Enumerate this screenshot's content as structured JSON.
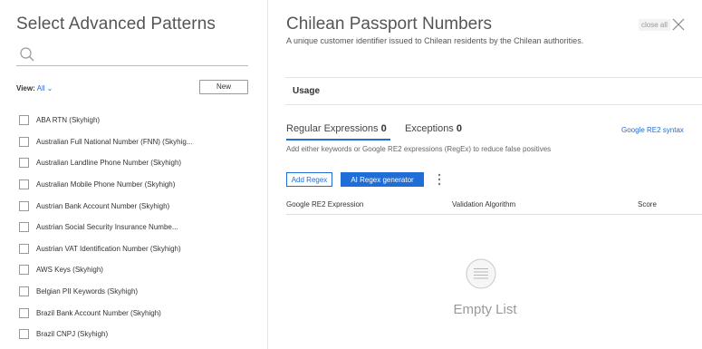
{
  "left_panel": {
    "title": "Select Advanced Patterns",
    "search": {
      "value": "",
      "placeholder": "",
      "icon": "search-icon"
    },
    "view": {
      "label": "View:",
      "value": "All"
    },
    "new_button_label": "New",
    "patterns": [
      {
        "label": "ABA RTN (Skyhigh)",
        "checked": false
      },
      {
        "label": "Australian Full National Number (FNN) (Skyhig...",
        "checked": false
      },
      {
        "label": "Australian Landline Phone Number (Skyhigh)",
        "checked": false
      },
      {
        "label": "Australian Mobile Phone Number (Skyhigh)",
        "checked": false
      },
      {
        "label": "Austrian Bank Account Number (Skyhigh)",
        "checked": false
      },
      {
        "label": "Austrian Social Security Insurance Numbe...",
        "checked": false
      },
      {
        "label": "Austrian VAT Identification Number (Skyhigh)",
        "checked": false
      },
      {
        "label": "AWS Keys (Skyhigh)",
        "checked": false
      },
      {
        "label": "Belgian PII Keywords (Skyhigh)",
        "checked": false
      },
      {
        "label": "Brazil Bank Account Number (Skyhigh)",
        "checked": false
      },
      {
        "label": "Brazil CNPJ (Skyhigh)",
        "checked": false
      }
    ]
  },
  "right_panel": {
    "title": "Chilean Passport Numbers",
    "subtitle": "A unique customer identifier issued to Chilean residents by the Chilean authorities.",
    "close_all_label": "close all",
    "usage_label": "Usage",
    "tabs": [
      {
        "label": "Regular Expressions",
        "count": "0",
        "active": true
      },
      {
        "label": "Exceptions",
        "count": "0",
        "active": false
      }
    ],
    "google_syntax_link": "Google RE2 syntax",
    "hint": "Add either keywords or Google RE2 expressions (RegEx) to reduce false positives",
    "add_regex_label": "Add Regex",
    "ai_regex_label": "AI Regex generator",
    "table_headers": {
      "expression": "Google RE2 Expression",
      "algorithm": "Validation Algorithm",
      "score": "Score"
    },
    "empty_text": "Empty List"
  },
  "colors": {
    "accent": "#1f6dd6",
    "text": "#333333",
    "muted": "#999999",
    "border": "#e3e3e3"
  }
}
